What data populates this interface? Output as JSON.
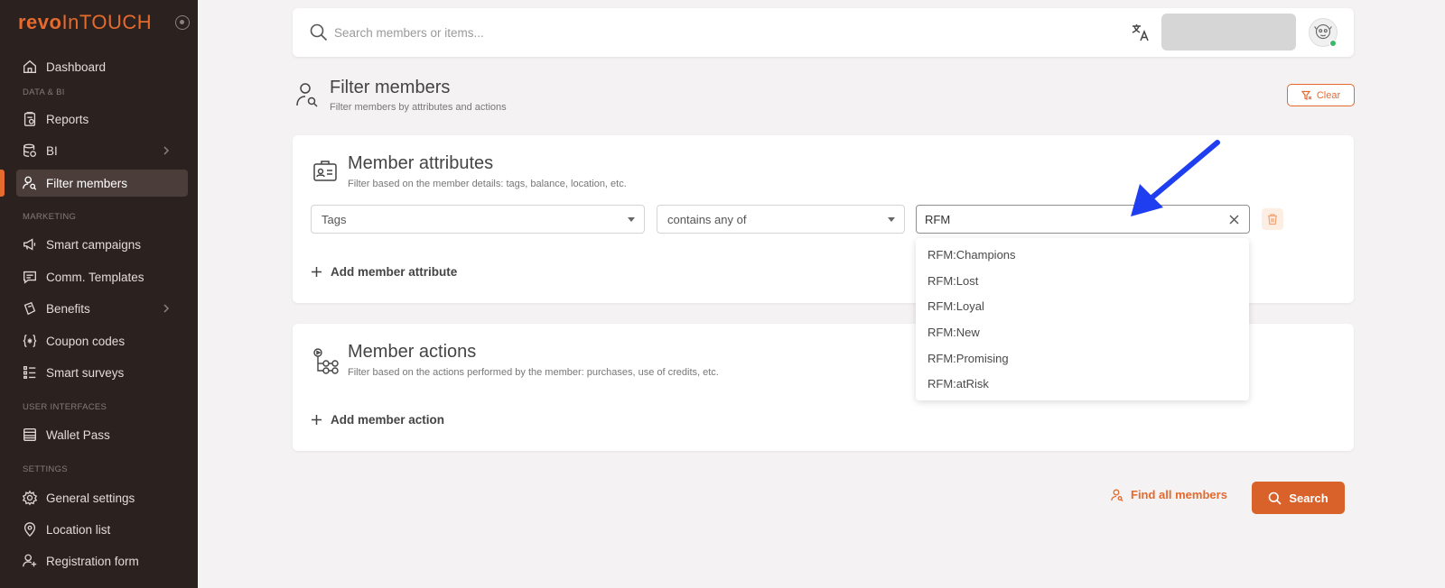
{
  "app": {
    "logo_bold": "revo",
    "logo_light": "InTOUCH"
  },
  "sidebar": {
    "items": [
      {
        "label": "Dashboard"
      },
      {
        "label": "Reports"
      },
      {
        "label": "BI"
      },
      {
        "label": "Filter members"
      },
      {
        "label": "Smart campaigns"
      },
      {
        "label": "Comm. Templates"
      },
      {
        "label": "Benefits"
      },
      {
        "label": "Coupon codes"
      },
      {
        "label": "Smart surveys"
      },
      {
        "label": "Wallet Pass"
      },
      {
        "label": "General settings"
      },
      {
        "label": "Location list"
      },
      {
        "label": "Registration form"
      }
    ],
    "sections": {
      "data_bi": "DATA & BI",
      "marketing": "MARKETING",
      "user_interfaces": "USER INTERFACES",
      "settings": "SETTINGS"
    }
  },
  "topbar": {
    "search_placeholder": "Search members or items..."
  },
  "page": {
    "title": "Filter members",
    "subtitle": "Filter members by attributes and actions",
    "clear_label": "Clear"
  },
  "attributes": {
    "title": "Member attributes",
    "subtitle": "Filter based on the member details: tags, balance, location, etc.",
    "field_select": "Tags",
    "operator_select": "contains any of",
    "value": "RFM",
    "add_label": "Add member attribute"
  },
  "dropdown": {
    "options": [
      "RFM:Champions",
      "RFM:Lost",
      "RFM:Loyal",
      "RFM:New",
      "RFM:Promising",
      "RFM:atRisk"
    ]
  },
  "actions": {
    "title": "Member actions",
    "subtitle": "Filter based on the actions performed by the member: purchases, use of credits, etc.",
    "add_label": "Add member action"
  },
  "footer": {
    "find_all_label": "Find all members",
    "search_label": "Search"
  },
  "colors": {
    "accent": "#e46a2e",
    "sidebar_bg": "#2b211f",
    "annotation_arrow": "#1f3ef0"
  }
}
